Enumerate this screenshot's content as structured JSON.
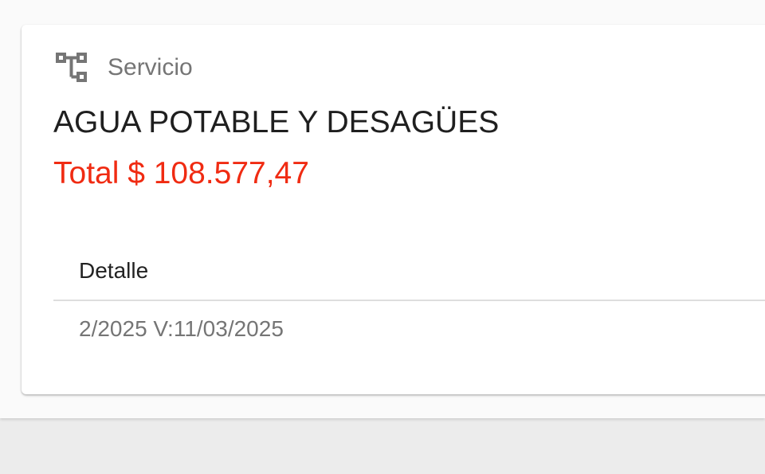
{
  "card": {
    "header_icon": "account-tree-icon",
    "header_label": "Servicio",
    "service_name": "AGUA POTABLE Y DESAGÜES",
    "total": "Total $ 108.577,47"
  },
  "table": {
    "column_header": "Detalle",
    "rows": [
      {
        "detalle": "2/2025 V:11/03/2025"
      }
    ]
  },
  "colors": {
    "total_accent": "#f02b12",
    "icon_gray": "#757575"
  }
}
